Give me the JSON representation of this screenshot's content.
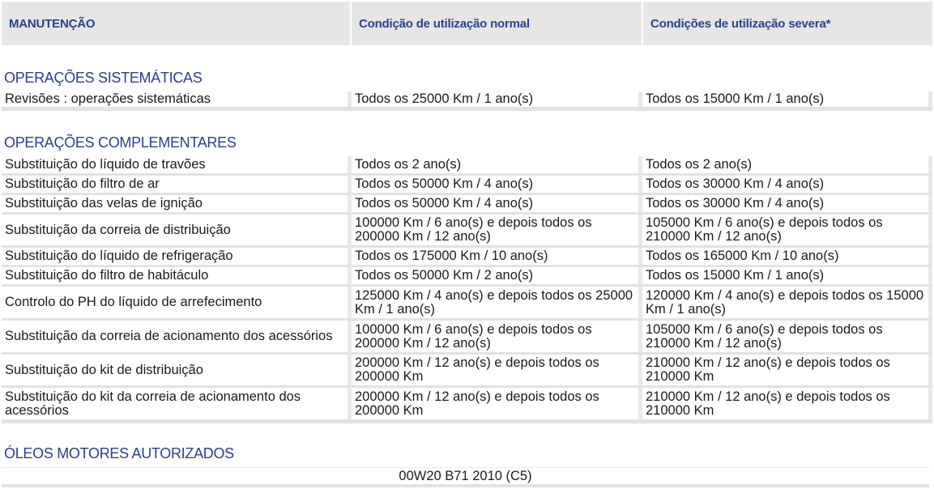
{
  "header": {
    "col1": "MANUTENÇÃO",
    "col2": "Condição de utilização normal",
    "col3": "Condições de utilização severa*"
  },
  "sections": {
    "systematic_title": "OPERAÇÕES SISTEMÁTICAS",
    "complementary_title": "OPERAÇÕES COMPLEMENTARES",
    "oils_title": "ÓLEOS MOTORES AUTORIZADOS"
  },
  "systematic_rows": [
    {
      "operation": "Revisões : operações sistemáticas",
      "normal": "Todos os 25000 Km / 1 ano(s)",
      "severe": "Todos os 15000 Km / 1 ano(s)"
    }
  ],
  "complementary_rows": [
    {
      "operation": "Substituição do líquido de travões",
      "normal": "Todos os 2 ano(s)",
      "severe": "Todos os 2 ano(s)"
    },
    {
      "operation": "Substituição do filtro de ar",
      "normal": "Todos os 50000 Km / 4 ano(s)",
      "severe": "Todos os 30000 Km / 4 ano(s)"
    },
    {
      "operation": "Substituição das velas de ignição",
      "normal": "Todos os 50000 Km / 4 ano(s)",
      "severe": "Todos os 30000 Km / 4 ano(s)"
    },
    {
      "operation": "Substituição da correia de distribuição",
      "normal": "100000 Km / 6 ano(s) e depois todos os 200000 Km / 12 ano(s)",
      "severe": "105000 Km / 6 ano(s) e depois todos os 210000 Km / 12 ano(s)"
    },
    {
      "operation": "Substituição do líquido de refrigeração",
      "normal": "Todos os 175000 Km / 10 ano(s)",
      "severe": "Todos os 165000 Km / 10 ano(s)"
    },
    {
      "operation": "Substituição do filtro de habitáculo",
      "normal": "Todos os 50000 Km / 2 ano(s)",
      "severe": "Todos os 15000 Km / 1 ano(s)"
    },
    {
      "operation": "Controlo do PH do líquido de arrefecimento",
      "normal": "125000 Km / 4 ano(s) e depois todos os 25000 Km / 1 ano(s)",
      "severe": "120000 Km / 4 ano(s) e depois todos os 15000 Km / 1 ano(s)"
    },
    {
      "operation": "Substituição da correia de acionamento dos acessórios",
      "normal": "100000 Km / 6 ano(s) e depois todos os 200000 Km / 12 ano(s)",
      "severe": "105000 Km / 6 ano(s) e depois todos os 210000 Km / 12 ano(s)"
    },
    {
      "operation": "Substituição do kit de distribuição",
      "normal": "200000 Km / 12 ano(s) e depois todos os 200000 Km",
      "severe": "210000 Km / 12 ano(s) e depois todos os 210000 Km"
    },
    {
      "operation": "Substituição do kit da correia de acionamento dos acessórios",
      "normal": "200000 Km / 12 ano(s) e depois todos os 200000 Km",
      "severe": "210000 Km / 12 ano(s) e depois todos os 210000 Km"
    }
  ],
  "oil_spec": "00W20 B71 2010 (C5)"
}
